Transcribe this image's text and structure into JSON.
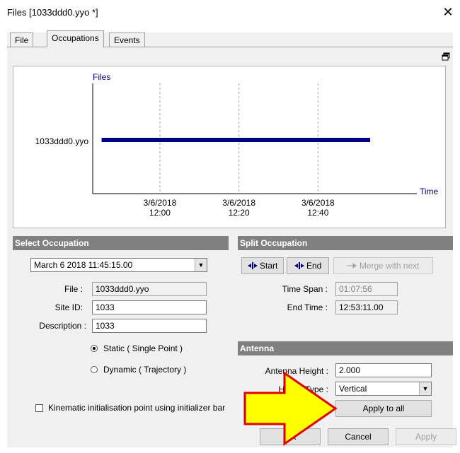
{
  "window": {
    "title": "Files [1033ddd0.yyo *]",
    "close_glyph": "✕"
  },
  "tabs": [
    {
      "label": "File",
      "active": false
    },
    {
      "label": "Occupations",
      "active": true
    },
    {
      "label": "Events",
      "active": false
    }
  ],
  "chart_data": {
    "type": "timeline",
    "ylabel": "Files",
    "xlabel": "Time",
    "row_labels": [
      "1033ddd0.yyo"
    ],
    "x_ticks": [
      {
        "date": "3/6/2018",
        "time": "12:00"
      },
      {
        "date": "3/6/2018",
        "time": "12:20"
      },
      {
        "date": "3/6/2018",
        "time": "12:40"
      }
    ],
    "x_range": [
      "11:43",
      "13:05"
    ],
    "series": [
      {
        "values": [
          {
            "start": "11:45:15",
            "end": "12:53:11"
          }
        ]
      }
    ],
    "bar_color": "#000080",
    "grid": true
  },
  "select_occupation": {
    "heading": "Select Occupation",
    "selected": "March 6 2018 11:45:15.00",
    "file_label": "File :",
    "file_value": "1033ddd0.yyo",
    "site_label": "Site ID:",
    "site_value": "1033",
    "desc_label": "Description :",
    "desc_value": "1033",
    "static_label": "Static ( Single Point )",
    "dynamic_label": "Dynamic ( Trajectory )",
    "kinematic_label": "Kinematic initialisation point using initializer bar"
  },
  "split_occupation": {
    "heading": "Split Occupation",
    "start_label": "Start",
    "end_label": "End",
    "merge_label": "Merge with next",
    "timespan_label": "Time Span :",
    "timespan_value": "01:07:56",
    "endtime_label": "End Time :",
    "endtime_value": "12:53:11.00"
  },
  "antenna": {
    "heading": "Antenna",
    "height_label": "Antenna Height :",
    "height_value": "2.000",
    "type_label": "Height Type :",
    "type_value": "Vertical",
    "apply_all_label": "Apply to all"
  },
  "footer": {
    "ok_label": "OK",
    "cancel_label": "Cancel",
    "apply_label": "Apply"
  },
  "colors": {
    "arrow_fill": "#ffff00",
    "arrow_stroke": "#e00000"
  }
}
